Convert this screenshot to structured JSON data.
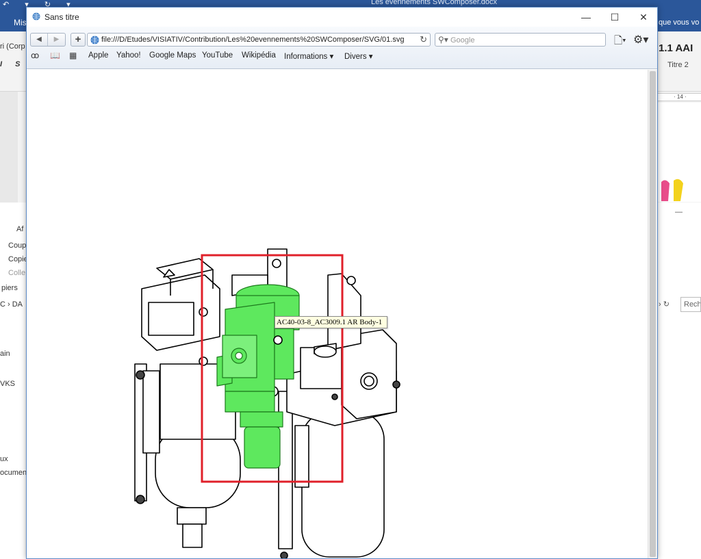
{
  "word": {
    "quick_access": "↶ ▾ ↻ ▾",
    "doc_title": "Les evennements SWComposer.docx",
    "ribbon_tab": "Mis",
    "tell_me": "que vous vo",
    "font_box": "ri (Corp",
    "format_chars": "I S",
    "style_1": "1.1  AAI",
    "style_2": "Titre 2",
    "ruler_mark": "· 14 ·",
    "clipboard_afficher": "Af",
    "clipboard_items": [
      "Coup",
      "Copie",
      "Colle"
    ],
    "clipboard_group": "piers",
    "explorer_path": "C › DA",
    "explorer_items": [
      "ain",
      "VKS",
      "ux",
      "ocument"
    ],
    "search_placeholder": "Rech"
  },
  "browser": {
    "window_title": "Sans titre",
    "controls": {
      "minimize": "—",
      "maximize": "☐",
      "close": "✕"
    },
    "url": "file:///D/Etudes/VISIATIV/Contribution/Les%20evennements%20SWComposer/SVG/01.svg",
    "search_placeholder": "Google",
    "bookmarks": [
      "Apple",
      "Yahoo!",
      "Google Maps",
      "YouTube",
      "Wikipédia",
      "Informations ▾",
      "Divers ▾"
    ]
  },
  "viewer": {
    "tooltip": "AC40-03-8_AC3009.1 AR Body-1",
    "highlight_color": "#5ee85e",
    "selection_color": "#e0202a"
  }
}
